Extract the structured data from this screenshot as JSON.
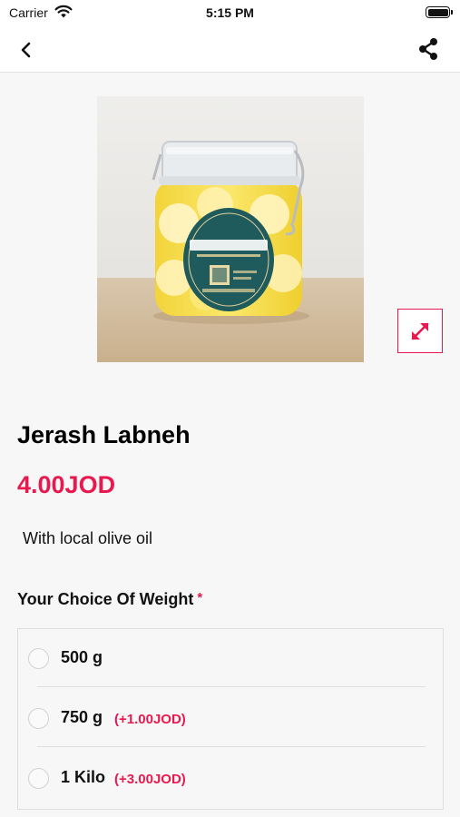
{
  "status_bar": {
    "carrier": "Carrier",
    "time": "5:15 PM"
  },
  "nav": {
    "back_icon": "chevron-left-icon",
    "share_icon": "share-icon"
  },
  "product": {
    "image_label": "jar-of-labneh-balls-in-olive-oil",
    "title": "Jerash Labneh",
    "price": "4.00JOD",
    "description": "With local olive oil",
    "expand_icon": "expand-diagonal-icon"
  },
  "options": {
    "heading": "Your Choice Of Weight",
    "required_mark": "*",
    "items": [
      {
        "label": "500 g",
        "extra": ""
      },
      {
        "label": "750 g",
        "extra": "(+1.00JOD)"
      },
      {
        "label": "1 Kilo",
        "extra": "(+3.00JOD)"
      }
    ]
  },
  "colors": {
    "accent": "#e8194f",
    "background": "#f7f7f7"
  }
}
